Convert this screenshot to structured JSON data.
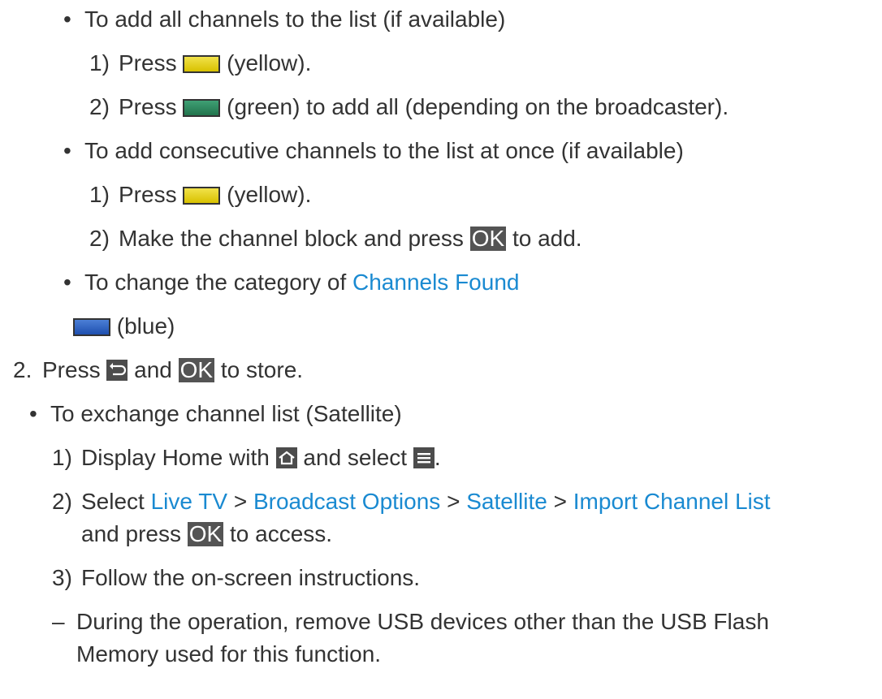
{
  "items": [
    {
      "bullet": "•",
      "text": "To add all channels to the list (if available)"
    },
    {
      "num": "1)",
      "pre": "Press",
      "button": "yellow",
      "post": "(yellow)."
    },
    {
      "num": "2)",
      "pre": "Press",
      "button": "green",
      "post": "(green) to add all (depending on the broadcaster)."
    },
    {
      "bullet": "•",
      "text": "To add consecutive channels to the list at once (if available)"
    },
    {
      "num": "1)",
      "pre": "Press",
      "button": "yellow",
      "post": "(yellow)."
    },
    {
      "num": "2)",
      "pre": "Make the channel block and press",
      "key": "OK",
      "post": "to add."
    },
    {
      "bullet": "•",
      "pre": "To change the category of",
      "link": "Channels Found"
    },
    {
      "button": "blue",
      "post": "(blue)"
    },
    {
      "num": "2.",
      "pre": "Press",
      "icon": "return-icon",
      "mid": "and",
      "key": "OK",
      "post": "to store."
    },
    {
      "bullet": "•",
      "text": "To exchange channel list (Satellite)"
    },
    {
      "num": "1)",
      "pre": "Display Home with",
      "icon": "home-icon",
      "mid": "and select",
      "icon2": "menu-icon",
      "post": "."
    },
    {
      "num": "2)",
      "pre": "Select",
      "links": [
        "Live TV",
        "Broadcast Options",
        "Satellite",
        "Import Channel List"
      ],
      "sep": ">"
    },
    {
      "pre": "and press",
      "key": "OK",
      "post": "to access."
    },
    {
      "num": "3)",
      "text": "Follow the on-screen instructions."
    },
    {
      "dash": "–",
      "text": "During the operation, remove USB devices other than the USB Flash"
    },
    {
      "text": "Memory used for this function."
    }
  ],
  "colors": {
    "text": "#333333",
    "link": "#1a8ad1",
    "ok_key_bg": "#545454"
  }
}
